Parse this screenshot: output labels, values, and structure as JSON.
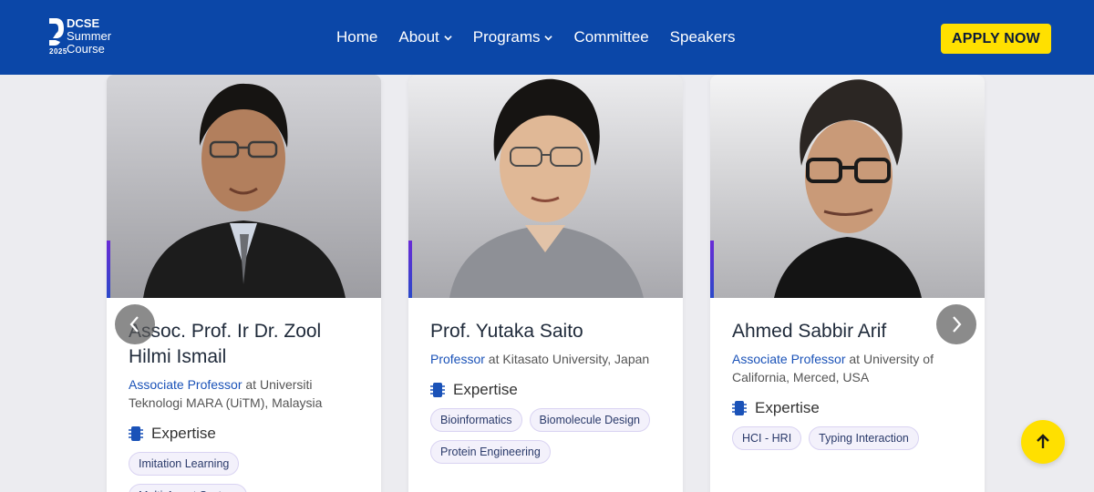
{
  "header": {
    "logo": {
      "line1": "DCSE",
      "line2": "Summer",
      "line3": "Course",
      "year": "2025"
    },
    "nav": [
      {
        "label": "Home",
        "has_dropdown": false
      },
      {
        "label": "About",
        "has_dropdown": true
      },
      {
        "label": "Programs",
        "has_dropdown": true
      },
      {
        "label": "Committee",
        "has_dropdown": false
      },
      {
        "label": "Speakers",
        "has_dropdown": false
      }
    ],
    "apply_label": "APPLY NOW"
  },
  "speakers": [
    {
      "name": "Assoc. Prof. Ir Dr. Zool Hilmi Ismail",
      "title": "Associate Professor",
      "affiliation": " at Universiti Teknologi MARA (UiTM), Malaysia",
      "expertise_label": "Expertise",
      "tags": [
        "Imitation Learning",
        "Multi-Agent System"
      ]
    },
    {
      "name": "Prof. Yutaka Saito",
      "title": "Professor",
      "affiliation": " at Kitasato University, Japan",
      "expertise_label": "Expertise",
      "tags": [
        "Bioinformatics",
        "Biomolecule Design",
        "Protein Engineering"
      ]
    },
    {
      "name": "Ahmed Sabbir Arif",
      "title": "Associate Professor",
      "affiliation": " at University of California, Merced, USA",
      "expertise_label": "Expertise",
      "tags": [
        "HCI - HRI",
        "Typing Interaction"
      ]
    }
  ],
  "icons": {
    "prev": "chevron-left-icon",
    "next": "chevron-right-icon",
    "scroll_top": "arrow-up-icon",
    "expertise": "chip-icon"
  },
  "colors": {
    "header_bg": "#0b47a8",
    "accent_yellow": "#ffe000",
    "link_blue": "#1a52b8"
  }
}
